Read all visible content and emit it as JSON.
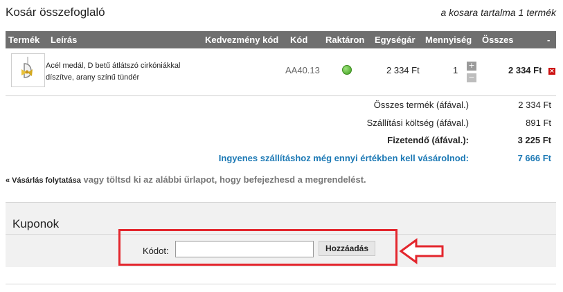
{
  "header": {
    "title": "Kosár összefoglaló",
    "cart_summary": "a kosara tartalma 1 termék"
  },
  "table": {
    "columns": [
      "Termék",
      "Leírás",
      "Kedvezmény kód",
      "Kód",
      "Raktáron",
      "Egységár",
      "Mennyiség",
      "Összes",
      "-"
    ],
    "rows": [
      {
        "description": "Acél medál, D betű átlátszó cirkóniákkal díszítve, arany színű tündér",
        "code": "AA40.13",
        "in_stock": true,
        "unit_price": "2 334 Ft",
        "quantity": "1",
        "total": "2 334 Ft",
        "plus": "+",
        "minus": "−",
        "remove": "×"
      }
    ]
  },
  "summary": {
    "items_label": "Összes termék (áfával.)",
    "items_value": "2 334 Ft",
    "shipping_label": "Szállítási költség (áfával.)",
    "shipping_value": "891 Ft",
    "payable_label": "Fizetendő (áfával.):",
    "payable_value": "3 225 Ft",
    "free_shipping_label": "Ingyenes szállításhoz még ennyi értékben kell vásárolnod:",
    "free_shipping_value": "7 666 Ft"
  },
  "continue": {
    "link": "« Vásárlás folytatása",
    "text": "vagy töltsd ki az alábbi űrlapot, hogy befejezhesd a megrendelést."
  },
  "coupons": {
    "title": "Kuponok",
    "code_label": "Kódot:",
    "code_value": "",
    "button_label": "Hozzáadás"
  },
  "colors": {
    "header_bg": "#6f6f6f",
    "accent_blue": "#1c79b5",
    "highlight_red": "#e3262d",
    "stock_green": "#4fb12a",
    "remove_red": "#cc1111"
  }
}
